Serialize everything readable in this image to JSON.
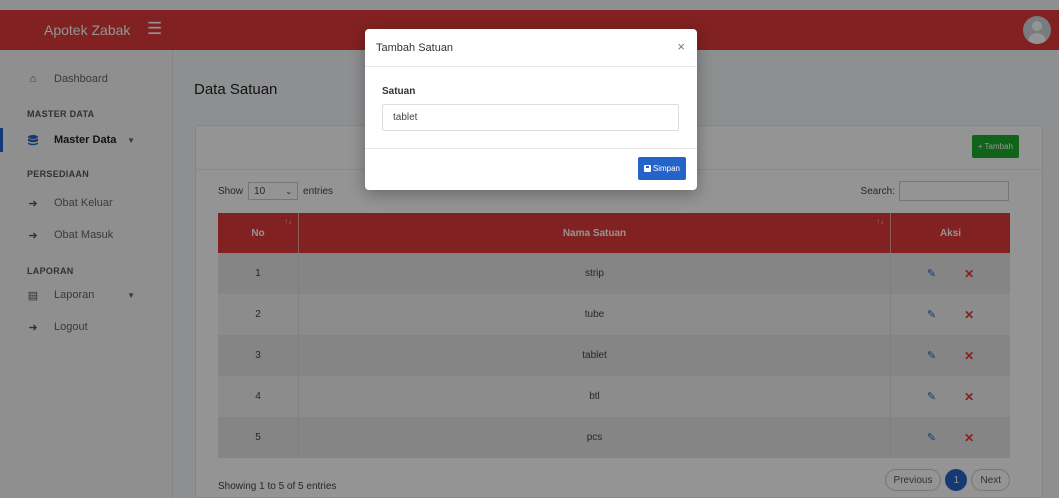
{
  "topbar": {
    "brand": "Apotek Zabak",
    "menu_icon": "hamburger-icon",
    "avatar_icon": "user-avatar-icon",
    "accent_color": "#e03a3a"
  },
  "sidebar": {
    "dashboard": "Dashboard",
    "heading_master": "MASTER DATA",
    "master_data": "Master Data",
    "heading_persediaan": "PERSEDIAAN",
    "obat_keluar": "Obat Keluar",
    "obat_masuk": "Obat Masuk",
    "heading_laporan": "LAPORAN",
    "laporan": "Laporan",
    "logout": "Logout"
  },
  "main": {
    "page_title": "Data Satuan",
    "add_button": "Tambah",
    "show_label": "Show",
    "entries_value": "10",
    "entries_label": "entries",
    "search_label": "Search:",
    "table": {
      "headers": [
        "No",
        "Nama Satuan",
        "Aksi"
      ],
      "rows": [
        {
          "no": "1",
          "nama": "strip"
        },
        {
          "no": "2",
          "nama": "tube"
        },
        {
          "no": "3",
          "nama": "tablet"
        },
        {
          "no": "4",
          "nama": "btl"
        },
        {
          "no": "5",
          "nama": "pcs"
        }
      ]
    },
    "showing": "Showing 1 to 5 of 5 entries",
    "pager": {
      "previous": "Previous",
      "current": "1",
      "next": "Next"
    }
  },
  "modal": {
    "title": "Tambah Satuan",
    "close": "×",
    "field_label": "Satuan",
    "field_value": "tablet",
    "save_button": "Simpan"
  }
}
